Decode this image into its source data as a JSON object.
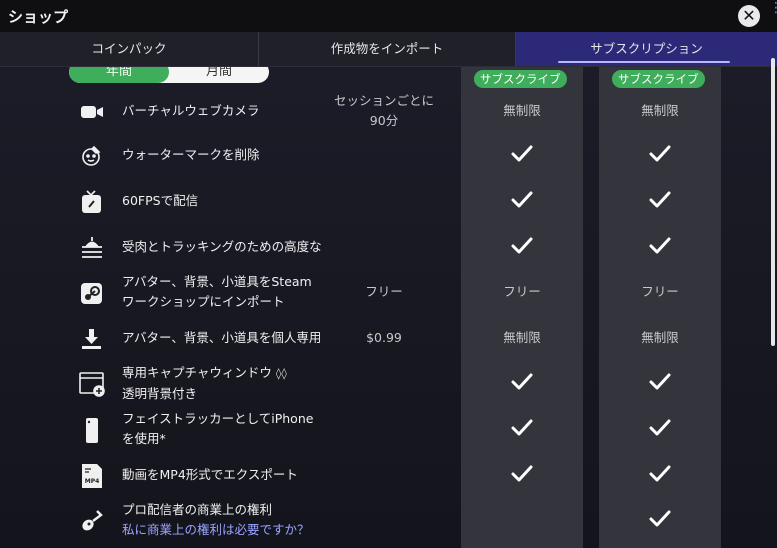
{
  "window": {
    "title": "ショップ"
  },
  "tabs": [
    {
      "label": "コインパック"
    },
    {
      "label": "作成物をインポート"
    },
    {
      "label": "サブスクリプション"
    }
  ],
  "period_toggle": {
    "yearly": "年間",
    "monthly": "月間"
  },
  "plans": [
    {
      "badge": "サブスクライブ"
    },
    {
      "badge": "サブスクライブ"
    }
  ],
  "features": [
    {
      "icon": "camera-icon",
      "label": [
        "バーチャルウェブカメラ"
      ],
      "free": [
        "セッションごとに",
        "90分"
      ],
      "plan1": "無制限",
      "plan2": "無制限"
    },
    {
      "icon": "watermark-icon",
      "label": [
        "ウォーターマークを削除"
      ],
      "free": [
        ""
      ],
      "plan1": "✓",
      "plan2": "✓"
    },
    {
      "icon": "tv-icon",
      "label": [
        "60FPSで配信"
      ],
      "free": [
        ""
      ],
      "plan1": "✓",
      "plan2": "✓"
    },
    {
      "icon": "tracking-icon",
      "label": [
        "受肉とトラッキングのための高度な"
      ],
      "free": [
        ""
      ],
      "plan1": "✓",
      "plan2": "✓"
    },
    {
      "icon": "steam-icon",
      "label": [
        "アバター、背景、小道具をSteam",
        "ワークショップにインポート"
      ],
      "free": [
        "フリー"
      ],
      "plan1": "フリー",
      "plan2": "フリー"
    },
    {
      "icon": "download-icon",
      "label": [
        "アバター、背景、小道具を個人専用"
      ],
      "free": [
        "$0.99"
      ],
      "plan1": "無制限",
      "plan2": "無制限"
    },
    {
      "icon": "window-add-icon",
      "label": [
        "専用キャプチャウィンドウ",
        "透明背景付き"
      ],
      "free": [
        ""
      ],
      "plan1": "✓",
      "plan2": "✓"
    },
    {
      "icon": "phone-icon",
      "label": [
        "フェイストラッカーとしてiPhone",
        "を使用*"
      ],
      "free": [
        ""
      ],
      "plan1": "✓",
      "plan2": "✓"
    },
    {
      "icon": "mp4-icon",
      "label": [
        "動画をMP4形式でエクスポート"
      ],
      "free": [
        ""
      ],
      "plan1": "✓",
      "plan2": "✓"
    },
    {
      "icon": "guitar-icon",
      "label": [
        "プロ配信者の商業上の権利",
        "私に商業上の権利は必要ですか？"
      ],
      "free": [
        ""
      ],
      "plan1": "",
      "plan2": "✓"
    }
  ]
}
